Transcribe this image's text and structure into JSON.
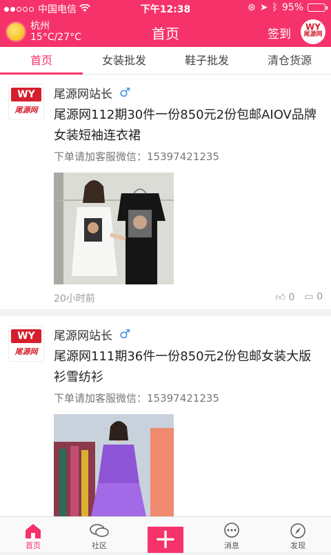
{
  "status_bar": {
    "carrier": "中国电信",
    "time": "下午12:38",
    "battery": "95%",
    "battery_level": 0.95
  },
  "header": {
    "city": "杭州",
    "temperature": "15°C/27°C",
    "title": "首页",
    "signin": "签到",
    "brand_color": "#f5336a"
  },
  "tabs": [
    {
      "label": "首页",
      "active": true
    },
    {
      "label": "女装批发",
      "active": false
    },
    {
      "label": "鞋子批发",
      "active": false
    },
    {
      "label": "清仓货源",
      "active": false
    }
  ],
  "posts": [
    {
      "author": "尾源网站长",
      "gender_icon": "male-icon",
      "title": "尾源网112期30件一份850元2份包邮AIOV品牌女装短袖连衣裙",
      "contact": "下单请加客服微信：15397421235",
      "time": "20小时前",
      "likes": "0",
      "comments": "0"
    },
    {
      "author": "尾源网站长",
      "gender_icon": "male-icon",
      "title": "尾源网111期36件一份850元2份包邮女装大版衫雪纺衫",
      "contact": "下单请加客服微信：15397421235"
    }
  ],
  "avatar": {
    "logo_text": "WY",
    "logo_name": "尾源网"
  },
  "tabbar": [
    {
      "label": "首页",
      "icon": "home-icon",
      "active": true
    },
    {
      "label": "社区",
      "icon": "chat-bubbles-icon",
      "active": false
    },
    {
      "label": "",
      "icon": "plus-icon",
      "active": false
    },
    {
      "label": "消息",
      "icon": "message-icon",
      "active": false
    },
    {
      "label": "发现",
      "icon": "compass-icon",
      "active": false
    }
  ]
}
